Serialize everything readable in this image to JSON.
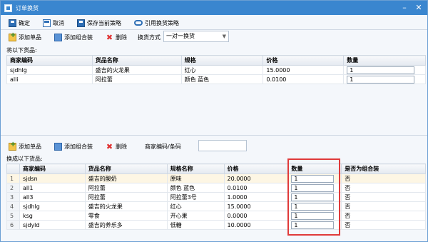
{
  "window": {
    "title": "订单换货"
  },
  "main_toolbar": {
    "confirm": "确定",
    "cancel": "取消",
    "save_strategy": "保存当前策略",
    "use_strategy": "引用换货策略"
  },
  "top_panel": {
    "add_single": "添加单品",
    "add_combo": "添加组合装",
    "delete": "删除",
    "mode_label": "换货方式",
    "mode_value": "一对一换货",
    "section_label": "将以下货品:",
    "columns": [
      "商家编码",
      "货品名称",
      "规格",
      "价格",
      "数量"
    ],
    "rows": [
      {
        "code": "sjdhlg",
        "name": "盛吉的火龙果",
        "spec": "红心",
        "price": "15.0000",
        "qty": "1"
      },
      {
        "code": "alli",
        "name": "阿拉蕾",
        "spec": "颜色 蓝色",
        "price": "0.0100",
        "qty": "1"
      }
    ]
  },
  "bottom_panel": {
    "add_single": "添加单品",
    "add_combo": "添加组合装",
    "delete": "删除",
    "search_label": "商家编码/条码",
    "search_value": "",
    "section_label": "换成以下货品:",
    "columns": [
      "商家编码",
      "货品名称",
      "规格名称",
      "价格",
      "数量",
      "是否为组合装"
    ],
    "rows": [
      {
        "n": "1",
        "code": "sjdsn",
        "name": "盛吉的酸奶",
        "spec": "原味",
        "price": "20.0000",
        "qty": "1",
        "combo": "否"
      },
      {
        "n": "2",
        "code": "all1",
        "name": "阿拉蕾",
        "spec": "颜色 蓝色",
        "price": "0.0100",
        "qty": "1",
        "combo": "否"
      },
      {
        "n": "3",
        "code": "all3",
        "name": "阿拉蕾",
        "spec": "阿拉蕾3号",
        "price": "1.0000",
        "qty": "1",
        "combo": "否"
      },
      {
        "n": "4",
        "code": "sjdhlg",
        "name": "盛吉的火龙果",
        "spec": "红心",
        "price": "15.0000",
        "qty": "1",
        "combo": "否"
      },
      {
        "n": "5",
        "code": "ksg",
        "name": "零食",
        "spec": "开心果",
        "price": "0.0000",
        "qty": "1",
        "combo": "否"
      },
      {
        "n": "6",
        "code": "sjdyld",
        "name": "盛吉的养乐多",
        "spec": "低糖",
        "price": "10.0000",
        "qty": "1",
        "combo": "否"
      }
    ]
  },
  "colors": {
    "titlebar": "#3a86cf",
    "highlight": "#e03a3a"
  }
}
